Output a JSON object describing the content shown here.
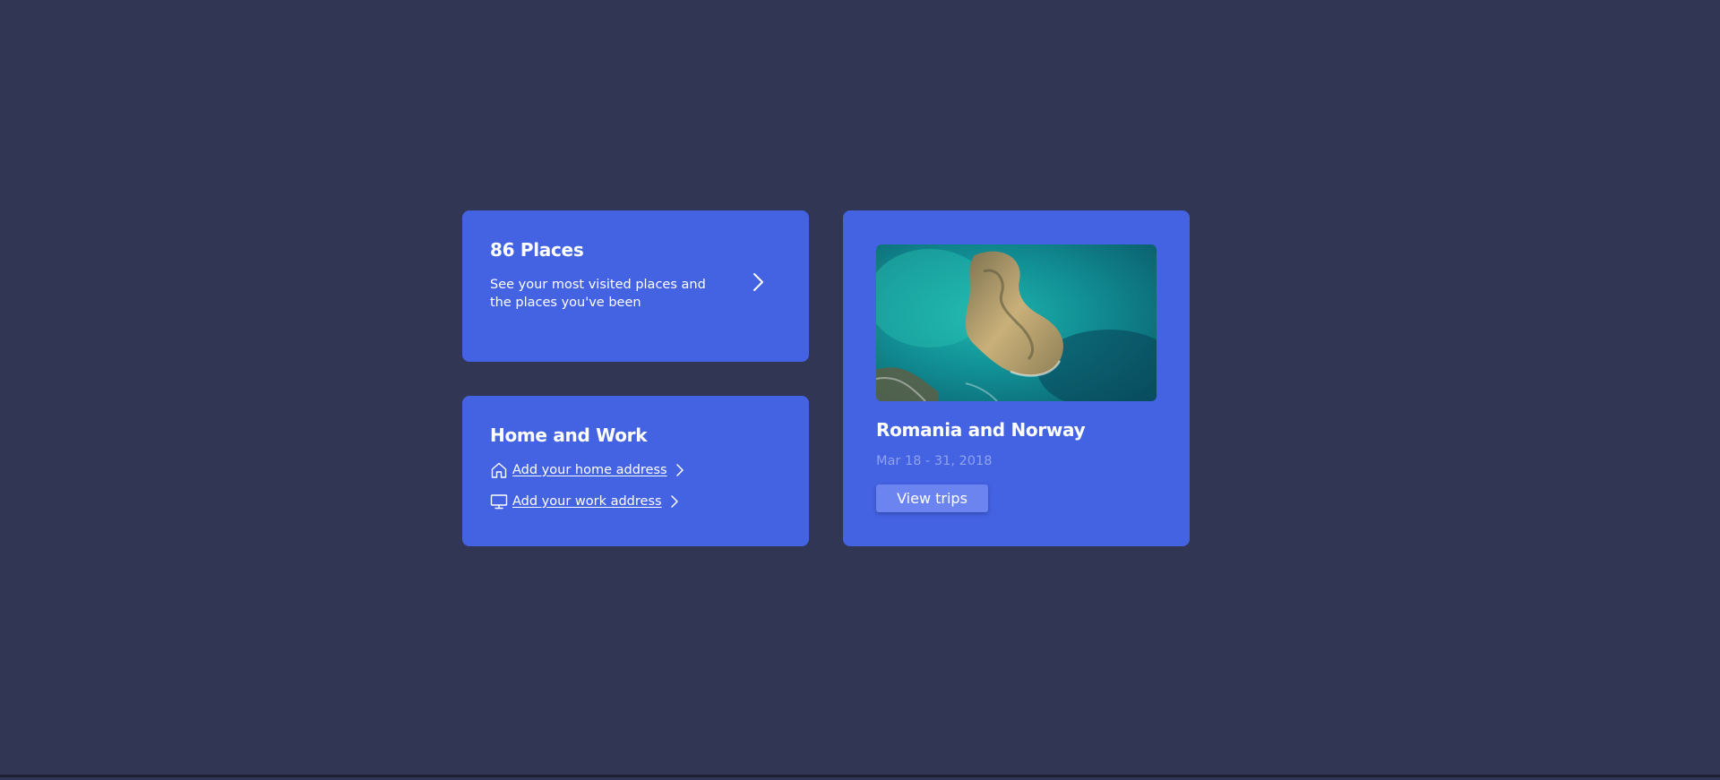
{
  "places_card": {
    "title": "86 Places",
    "description": "See your most visited places and the places you've been",
    "arrow_icon": "chevron-right-icon"
  },
  "home_work_card": {
    "title": "Home and Work",
    "links": [
      {
        "label": "Add your home address",
        "icon": "home-icon"
      },
      {
        "label": "Add your work address",
        "icon": "monitor-icon"
      }
    ]
  },
  "trip_card": {
    "image": "aerial-island-photo",
    "title": "Romania and Norway",
    "dates": "Mar 18 - 31, 2018",
    "button_label": "View trips"
  },
  "colors": {
    "background": "#303653",
    "card": "#4463e3",
    "button": "#6b84ef",
    "muted_text": "#8fa2f0",
    "text": "#ffffff"
  }
}
